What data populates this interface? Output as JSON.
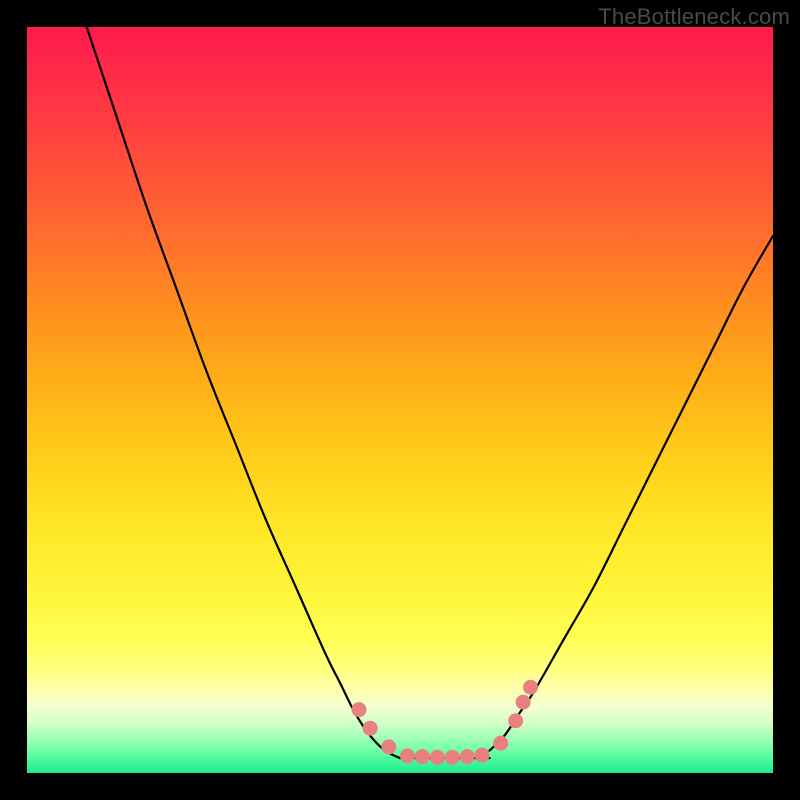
{
  "watermark": "TheBottleneck.com",
  "colors": {
    "curve_stroke": "#000000",
    "marker_fill": "#e98080",
    "background": "#000000"
  },
  "chart_data": {
    "type": "line",
    "title": "",
    "xlabel": "",
    "ylabel": "",
    "xlim": [
      0,
      100
    ],
    "ylim": [
      0,
      100
    ],
    "note": "Axes are unlabeled in the image; values below are estimated pixel-fraction percentages read from the plotted curve and markers.",
    "series": [
      {
        "name": "left_branch",
        "x": [
          8,
          12,
          16,
          20,
          24,
          28,
          32,
          36,
          40,
          42,
          44,
          46,
          48,
          50
        ],
        "y": [
          100,
          88,
          76,
          65,
          54,
          44,
          34,
          25,
          16,
          12,
          8,
          5,
          3,
          2
        ]
      },
      {
        "name": "valley",
        "x": [
          50,
          52,
          54,
          56,
          58,
          60,
          62
        ],
        "y": [
          2,
          2,
          2,
          2,
          2,
          2,
          2
        ]
      },
      {
        "name": "right_branch",
        "x": [
          62,
          64,
          66,
          68,
          72,
          76,
          80,
          84,
          88,
          92,
          96,
          100
        ],
        "y": [
          3,
          5,
          8,
          11,
          18,
          25,
          33,
          41,
          49,
          57,
          65,
          72
        ]
      }
    ],
    "markers": [
      {
        "x": 44.5,
        "y": 8.5
      },
      {
        "x": 46.0,
        "y": 6.0
      },
      {
        "x": 48.5,
        "y": 3.5
      },
      {
        "x": 51.0,
        "y": 2.3
      },
      {
        "x": 53.0,
        "y": 2.2
      },
      {
        "x": 55.0,
        "y": 2.1
      },
      {
        "x": 57.0,
        "y": 2.1
      },
      {
        "x": 59.0,
        "y": 2.2
      },
      {
        "x": 61.0,
        "y": 2.4
      },
      {
        "x": 63.5,
        "y": 4.0
      },
      {
        "x": 65.5,
        "y": 7.0
      },
      {
        "x": 66.5,
        "y": 9.5
      },
      {
        "x": 67.5,
        "y": 11.5
      }
    ]
  }
}
